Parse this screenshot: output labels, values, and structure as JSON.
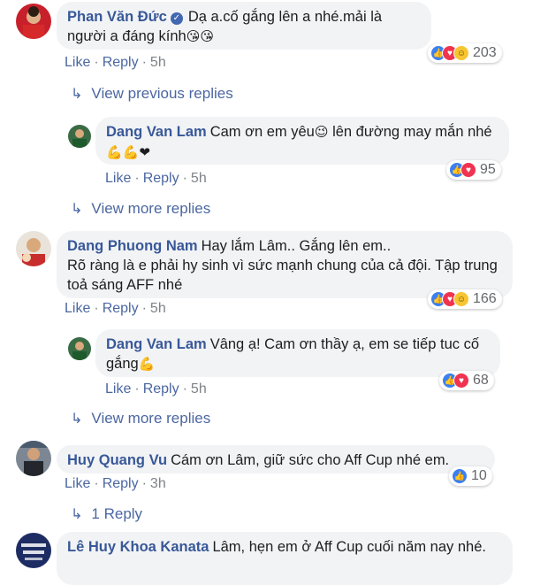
{
  "comments": [
    {
      "author": "Phan Văn Đức",
      "text": "Dạ a.cố gắng lên a nhé.mải là người a đáng kính",
      "emoji": "😘😘",
      "like": "Like",
      "reply": "Reply",
      "time": "5h",
      "reactions": "203"
    },
    {
      "author": "Dang Van Lam",
      "text": "Cam ơn em yêu",
      "text2": "lên đường may mắn nhé",
      "emoji1": "😉",
      "emoji2": "💪💪❤",
      "like": "Like",
      "reply": "Reply",
      "time": "5h",
      "reactions": "95"
    },
    {
      "author": "Dang Phuong Nam",
      "text": "Hay lắm Lâm.. Gắng lên em..",
      "text2": "Rõ ràng là e phải hy sinh vì sức mạnh chung của cả đội. Tập trung toả sáng AFF nhé",
      "like": "Like",
      "reply": "Reply",
      "time": "5h",
      "reactions": "166"
    },
    {
      "author": "Dang Van Lam",
      "text": "Vâng ạ! Cam ơn thầy ạ, em se tiếp tuc cố gắng",
      "emoji": "💪",
      "like": "Like",
      "reply": "Reply",
      "time": "5h",
      "reactions": "68"
    },
    {
      "author": "Huy Quang Vu",
      "text": "Cám ơn Lâm, giữ sức cho Aff Cup nhé em.",
      "like": "Like",
      "reply": "Reply",
      "time": "3h",
      "reactions": "10"
    },
    {
      "author": "Lê Huy Khoa Kanata",
      "text": "Lâm, hẹn em ở Aff Cup cuối năm nay nhé."
    }
  ],
  "links": {
    "view_previous": "View previous replies",
    "view_more_1": "View more replies",
    "view_more_2": "View more replies",
    "one_reply": "1 Reply"
  },
  "icons": {
    "reply_arrow": "reply-arrow-icon",
    "like": "like-reaction-icon",
    "love": "love-reaction-icon",
    "haha": "haha-reaction-icon",
    "verified": "verified-badge-icon"
  },
  "colors": {
    "author": "#385898",
    "link": "#4b67a1",
    "bubble": "#f2f3f5",
    "meta": "#7f8489"
  }
}
